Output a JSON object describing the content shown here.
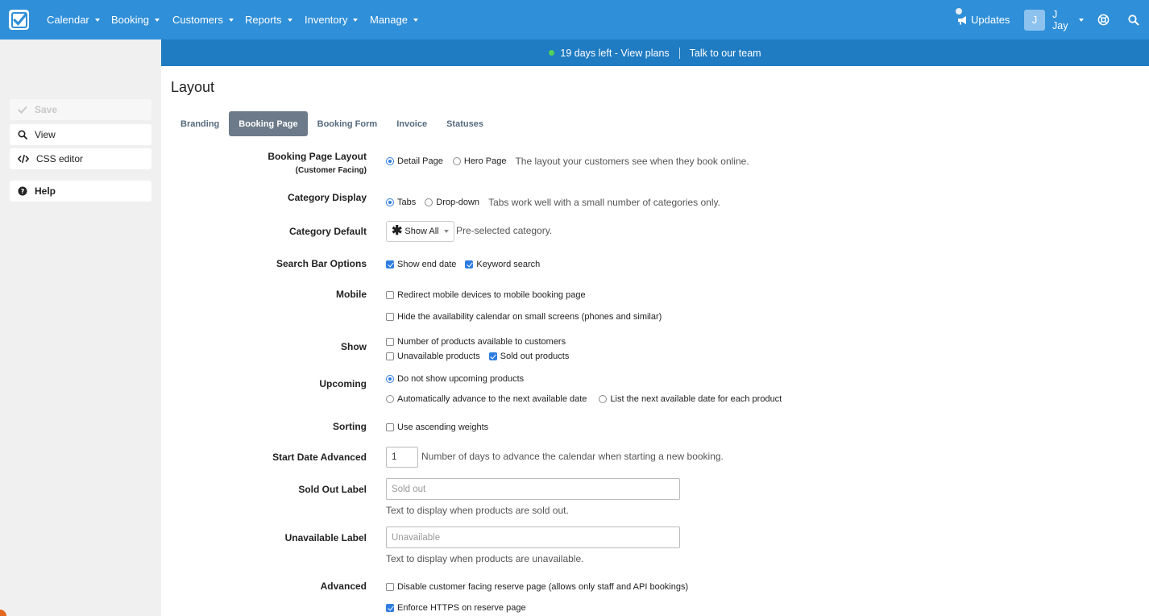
{
  "navbar": {
    "menus": [
      {
        "label": "Calendar"
      },
      {
        "label": "Booking"
      },
      {
        "label": "Customers"
      },
      {
        "label": "Reports"
      },
      {
        "label": "Inventory"
      },
      {
        "label": "Manage"
      }
    ],
    "updates_label": "Updates",
    "user_initial": "J",
    "user_name_line1": "J",
    "user_name_line2": "Jay",
    "icons": [
      "checkmark-logo-icon",
      "megaphone-icon",
      "globe-icon",
      "search-icon"
    ]
  },
  "banner": {
    "trial_text": "19 days left - View plans",
    "contact_text": "Talk to our team",
    "status_color": "#4fd15a"
  },
  "sidebar": {
    "save_label": "Save",
    "view_label": "View",
    "css_editor_label": "CSS editor",
    "help_label": "Help"
  },
  "page": {
    "title": "Layout",
    "tabs": [
      {
        "label": "Branding",
        "active": false
      },
      {
        "label": "Booking Page",
        "active": true
      },
      {
        "label": "Booking Form",
        "active": false
      },
      {
        "label": "Invoice",
        "active": false
      },
      {
        "label": "Statuses",
        "active": false
      }
    ]
  },
  "form": {
    "booking_page_layout": {
      "label": "Booking Page Layout",
      "sub": "(Customer Facing)",
      "options": [
        "Detail Page",
        "Hero Page"
      ],
      "selected": "Detail Page",
      "help": "The layout your customers see when they book online."
    },
    "category_display": {
      "label": "Category Display",
      "options": [
        "Tabs",
        "Drop-down"
      ],
      "selected": "Tabs",
      "help": "Tabs work well with a small number of categories only."
    },
    "category_default": {
      "label": "Category Default",
      "value": "Show All",
      "help": "Pre-selected category."
    },
    "search_bar_options": {
      "label": "Search Bar Options",
      "show_end_date": "Show end date",
      "keyword_search": "Keyword search"
    },
    "mobile": {
      "label": "Mobile",
      "redirect": "Redirect mobile devices to mobile booking page",
      "hide_calendar": "Hide the availability calendar on small screens (phones and similar)"
    },
    "show": {
      "label": "Show",
      "num_products": "Number of products available to customers",
      "unavailable": "Unavailable products",
      "sold_out": "Sold out products"
    },
    "upcoming": {
      "label": "Upcoming",
      "do_not_show": "Do not show upcoming products",
      "auto_advance": "Automatically advance to the next available date",
      "list_next": "List the next available date for each product",
      "selected": "Do not show upcoming products"
    },
    "sorting": {
      "label": "Sorting",
      "ascending": "Use ascending weights"
    },
    "start_date_advanced": {
      "label": "Start Date Advanced",
      "value": "1",
      "help": "Number of days to advance the calendar when starting a new booking."
    },
    "sold_out_label": {
      "label": "Sold Out Label",
      "placeholder": "Sold out",
      "help": "Text to display when products are sold out."
    },
    "unavailable_label": {
      "label": "Unavailable Label",
      "placeholder": "Unavailable",
      "help": "Text to display when products are unavailable."
    },
    "advanced": {
      "label": "Advanced",
      "disable_reserve": "Disable customer facing reserve page (allows only staff and API bookings)",
      "enforce_https": "Enforce HTTPS on reserve page"
    }
  }
}
